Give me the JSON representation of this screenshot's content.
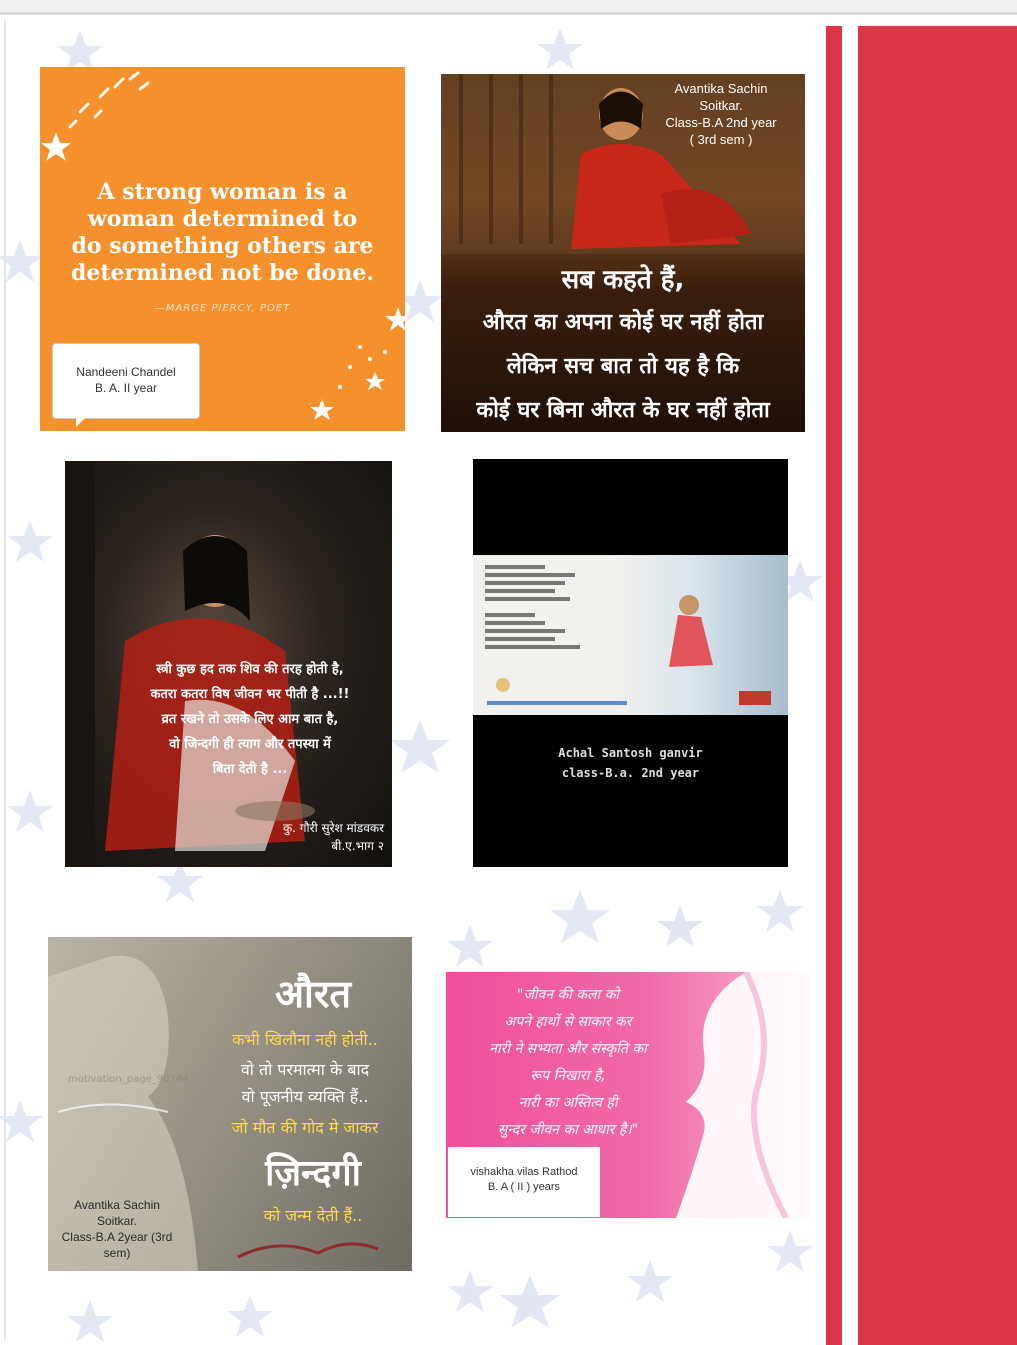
{
  "cards": [
    {
      "quote": "A strong woman is a woman determined to do something others are determined not be done.",
      "attribution": "—MARGE PIERCY, POET",
      "author": [
        "Nandeeni Chandel",
        "B. A. II year"
      ]
    },
    {
      "caption": [
        "Avantika Sachin",
        "Soitkar.",
        "Class-B.A 2nd year",
        "( 3rd sem )"
      ],
      "text": [
        "सब कहते हैं,",
        "औरत का अपना कोई घर नहीं होता",
        "लेकिन सच बात तो यह है कि",
        "कोई घर बिना औरत के घर नहीं होता"
      ]
    },
    {
      "poem": [
        "स्त्री कुछ हद तक शिव की तरह होती है,",
        "कतरा कतरा विष जीवन भर पीती है ...!!",
        "व्रत रखने तो उसके लिए आम बात है,",
        "वो जिन्दगी ही त्याग और तपस्या में",
        "बिता देती है ..."
      ],
      "signature": [
        "कु. गौरी सुरेश मांडवकर",
        "बी.ए.भाग २"
      ]
    },
    {
      "caption": [
        "Achal Santosh ganvir",
        "class-B.a. 2nd year"
      ]
    },
    {
      "title": "औरत",
      "lines": [
        "कभी खिलौना नही होती..",
        "वो तो परमात्मा के बाद",
        "वो पूजनीय व्यक्ति हैं..",
        "जो मौत की गोद मे जाकर"
      ],
      "big": "ज़िन्दगी",
      "last": "को जन्म देती हैं..",
      "watermark": "motivation_page_90744",
      "caption": [
        "Avantika Sachin",
        "Soitkar.",
        "Class-B.A 2year (3rd",
        "sem)"
      ]
    },
    {
      "poem": [
        "\"जीवन की कला को",
        "अपने हाथों से साकार कर",
        "नारी ने सभ्यता और संस्कृति का",
        "रूप निखारा है,",
        "नारी का अस्तित्व ही",
        "सुन्दर जीवन का आधार है।\""
      ],
      "author": [
        "vishakha vilas Rathod",
        "B. A ( II ) years"
      ]
    }
  ],
  "colors": {
    "red_stripe": "#dc3545",
    "orange_card": "#f4912c",
    "pink_card": "#ef4f9b"
  }
}
